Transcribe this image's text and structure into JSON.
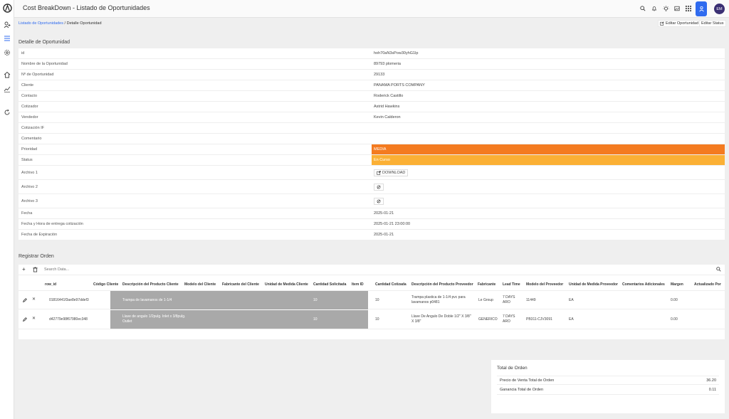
{
  "app": {
    "title": "Cost BreakDown - Listado de Oportunidades",
    "avatar_initials": "EM",
    "accent": "#2f6bef"
  },
  "breadcrumb": {
    "link": "Listado de Oportunidades",
    "separator": " / ",
    "current": "Detalle Oportunidad"
  },
  "header_buttons": {
    "edit_opportunity": "Editar Oportunidad",
    "edit_status": "Editar Status"
  },
  "detail": {
    "title": "Detalle de Oportunidad",
    "rows": [
      {
        "label": "id",
        "value": "hoh70aN3sPow30yhG1lp"
      },
      {
        "label": "Nombre de la Oportunidad",
        "value": "89793 plomeria"
      },
      {
        "label": "Nº de Oportunidad",
        "value": "29133"
      },
      {
        "label": "Cliente",
        "value": "PANAMA PORTS COMPANY"
      },
      {
        "label": "Contacto",
        "value": "Roderick Castillo"
      },
      {
        "label": "Cotizador",
        "value": "Astrid Hawkins"
      },
      {
        "label": "Vendedor",
        "value": "Kevin Calderon"
      },
      {
        "label": "Cotización IF",
        "value": ""
      },
      {
        "label": "Comentario",
        "value": ""
      },
      {
        "label": "Prioridad",
        "value": "MEDIA"
      },
      {
        "label": "Status",
        "value": "En Curso"
      },
      {
        "label": "Archivo 1",
        "value": "DOWNLOAD"
      },
      {
        "label": "Archivo 2",
        "value": ""
      },
      {
        "label": "Archivo 3",
        "value": ""
      },
      {
        "label": "Fecha",
        "value": "2025-01-21"
      },
      {
        "label": "Fecha y Hora de entrega cotización",
        "value": "2025-01-21 23:00:00"
      },
      {
        "label": "Fecha de Expiración",
        "value": "2025-01-21"
      }
    ],
    "priority_color": "#f47b20",
    "status_color": "#fbb035"
  },
  "orders": {
    "title": "Registrar Orden",
    "search_placeholder": "Search Data...",
    "columns": [
      "row_id",
      "Código Cliente",
      "Descripción del Producto Cliente",
      "Modelo del Cliente",
      "Fabricante del Cliente",
      "Unidad de Medida Cliente",
      "Cantidad Solicitada",
      "Item ID",
      "Cantidad Cotizada",
      "Descripción del Producto Proveedor",
      "Fabricante",
      "Lead Time",
      "Modelo del Proveedor",
      "Unidad de Medida Proveedor",
      "Comentarios Adicionales",
      "Margen",
      "Actualizado Por"
    ],
    "rows": [
      {
        "row_id": "01816441f3ae8e97ddef3",
        "desc_cliente": "Trampa de lavamanos de 1-1/4",
        "cant_solicitada": "10",
        "cant_cotizada": "10",
        "desc_proveedor": "Trampa plastica de 1-1/4 pvc para lavamanos p0481",
        "fabricante": "Le Group",
        "lead_time": "7 DAYS ARO",
        "modelo_proveedor": "11449",
        "unidad_proveedor": "EA",
        "margen": "0.00"
      },
      {
        "row_id": "d42779e98f67980ec348",
        "desc_cliente": "Llave de angulo 1/2pulg. Inlet x 3/8pulg. Outlet",
        "cant_solicitada": "10",
        "cant_cotizada": "10",
        "desc_proveedor": "Llave De Angulo De Doble 1/2\" X 3/8\" X 3/8\"",
        "fabricante": "GENERICO",
        "lead_time": "7 DAYS ARO",
        "modelo_proveedor": "PB311-CJV3091",
        "unidad_proveedor": "EA",
        "margen": "0.00"
      }
    ]
  },
  "totals": {
    "title": "Total de Orden",
    "rows": [
      {
        "label": "Precio de Venta Total de Orden",
        "value": "36.20"
      },
      {
        "label": "Ganancia Total de Orden",
        "value": "0.11"
      }
    ]
  }
}
